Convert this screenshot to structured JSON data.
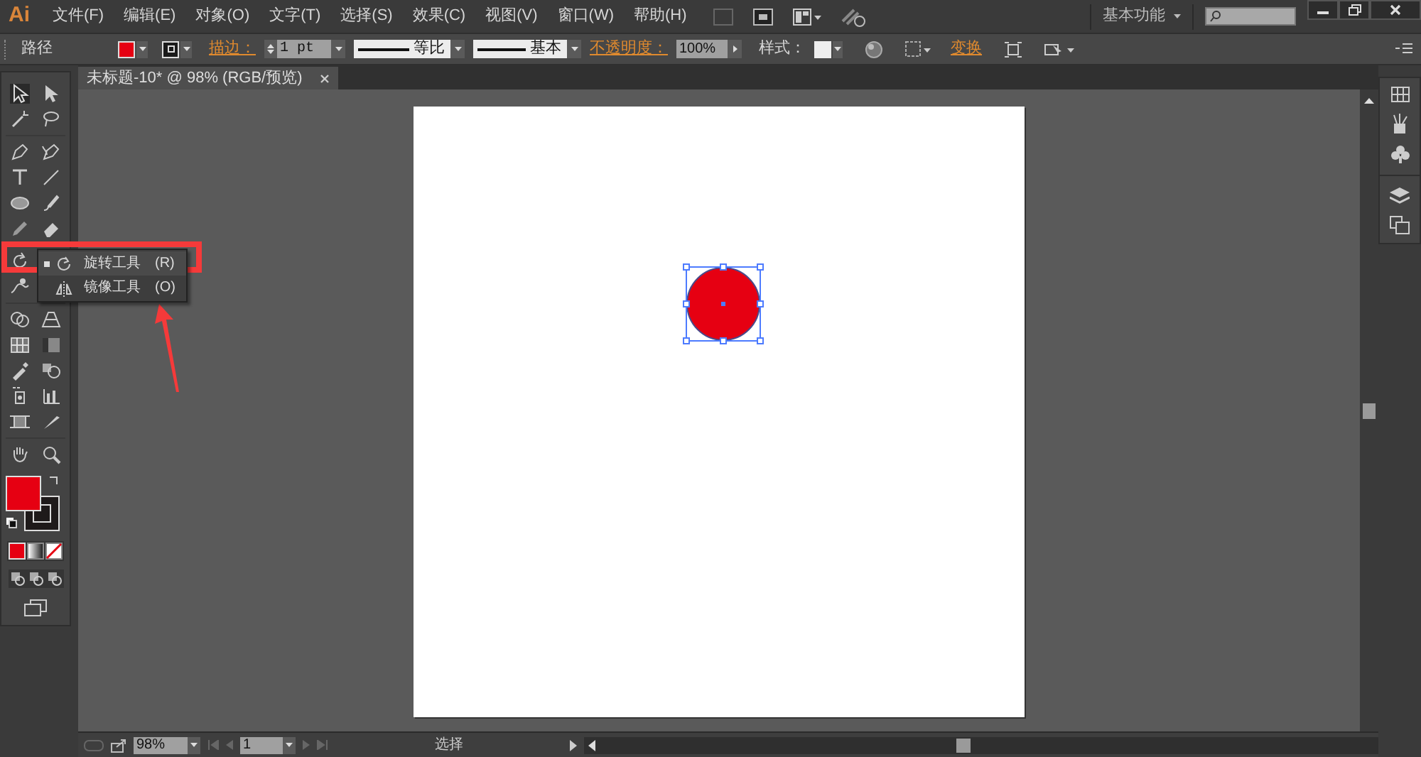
{
  "app": {
    "logo": "Ai"
  },
  "menu": [
    "文件(F)",
    "编辑(E)",
    "对象(O)",
    "文字(T)",
    "选择(S)",
    "效果(C)",
    "视图(V)",
    "窗口(W)",
    "帮助(H)"
  ],
  "workspace": "基本功能",
  "control_bar": {
    "object_type": "路径",
    "stroke_label": "描边：",
    "stroke_weight": "1 pt",
    "stroke_profile": "等比",
    "brush": "基本",
    "opacity_label": "不透明度：",
    "opacity": "100%",
    "style_label": "样式：",
    "transform_link": "变换"
  },
  "document_tab": {
    "title": "未标题-10* @ 98% (RGB/预览)"
  },
  "tool_flyout": [
    {
      "label": "旋转工具",
      "shortcut": "(R)",
      "selected": true
    },
    {
      "label": "镜像工具",
      "shortcut": "(O)",
      "selected": false
    }
  ],
  "status_bar": {
    "zoom": "98%",
    "artboard": "1",
    "tool": "选择"
  }
}
